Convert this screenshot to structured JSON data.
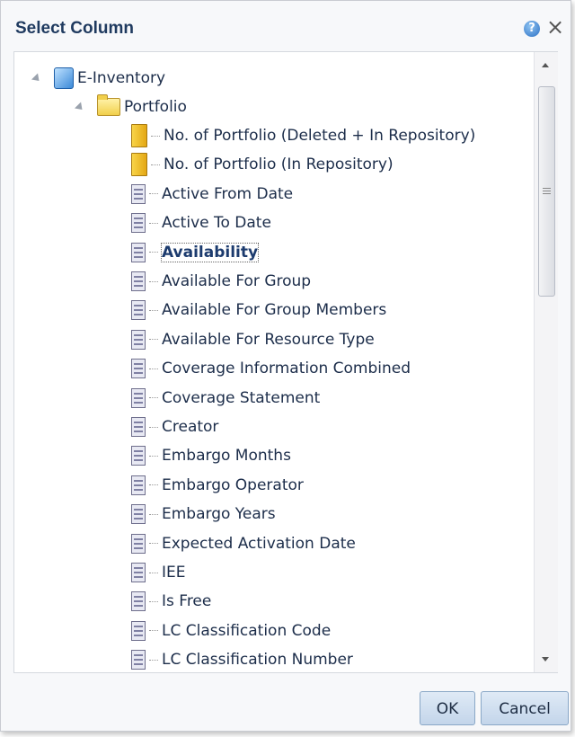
{
  "dialog": {
    "title": "Select Column",
    "help_icon": "?",
    "close_icon": "×"
  },
  "tree": {
    "root": {
      "label": "E-Inventory",
      "icon": "cube-icon"
    },
    "folder": {
      "label": "Portfolio",
      "icon": "folder-icon"
    },
    "items": [
      {
        "label": "No. of Portfolio (Deleted + In Repository)",
        "icon": "measure-icon"
      },
      {
        "label": "No. of Portfolio (In Repository)",
        "icon": "measure-icon"
      },
      {
        "label": "Active From Date",
        "icon": "column-icon"
      },
      {
        "label": "Active To Date",
        "icon": "column-icon"
      },
      {
        "label": "Availability",
        "icon": "column-icon",
        "selected": true
      },
      {
        "label": "Available For Group",
        "icon": "column-icon"
      },
      {
        "label": "Available For Group Members",
        "icon": "column-icon"
      },
      {
        "label": "Available For Resource Type",
        "icon": "column-icon"
      },
      {
        "label": "Coverage Information Combined",
        "icon": "column-icon"
      },
      {
        "label": "Coverage Statement",
        "icon": "column-icon"
      },
      {
        "label": "Creator",
        "icon": "column-icon"
      },
      {
        "label": "Embargo Months",
        "icon": "column-icon"
      },
      {
        "label": "Embargo Operator",
        "icon": "column-icon"
      },
      {
        "label": "Embargo Years",
        "icon": "column-icon"
      },
      {
        "label": "Expected Activation Date",
        "icon": "column-icon"
      },
      {
        "label": "IEE",
        "icon": "column-icon"
      },
      {
        "label": "Is Free",
        "icon": "column-icon"
      },
      {
        "label": "LC Classification Code",
        "icon": "column-icon"
      },
      {
        "label": "LC Classification Number",
        "icon": "column-icon"
      }
    ]
  },
  "buttons": {
    "ok_label": "OK",
    "cancel_label": "Cancel"
  }
}
